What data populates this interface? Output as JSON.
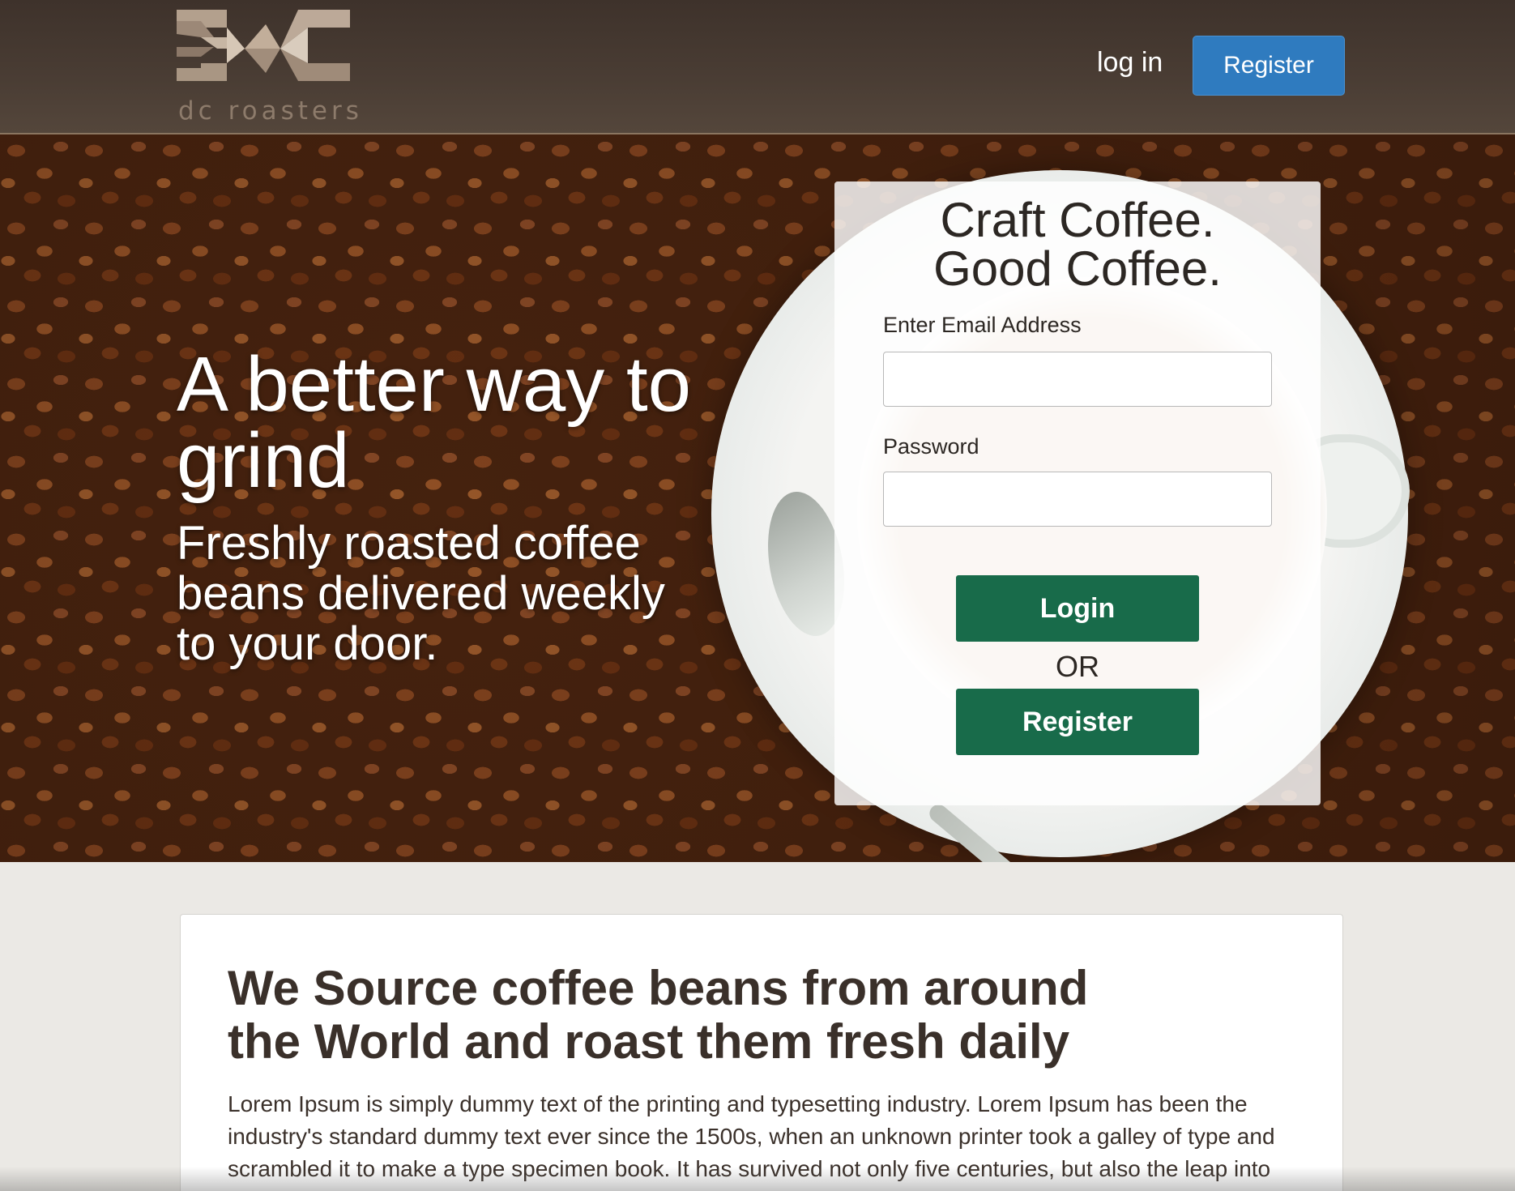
{
  "header": {
    "logo_text": "dc roasters",
    "login_label": "log in",
    "register_label": "Register"
  },
  "hero": {
    "title": "A better way to grind",
    "subtitle": "Freshly roasted coffee beans delivered weekly to your door."
  },
  "login_panel": {
    "title_line1": "Craft Coffee.",
    "title_line2": "Good Coffee.",
    "email_label": "Enter Email Address",
    "email_value": "",
    "password_label": "Password",
    "password_value": "",
    "login_button": "Login",
    "or_text": "OR",
    "register_button": "Register"
  },
  "about": {
    "heading": "We Source coffee beans from around the World and roast them fresh daily",
    "body": "Lorem Ipsum is simply dummy text of the printing and typesetting industry. Lorem Ipsum has been the industry's standard dummy text ever since the 1500s, when an unknown printer took a galley of type and scrambled it to make a type specimen book. It has survived not only five centuries, but also the leap into"
  },
  "colors": {
    "header_bg": "#4a3d34",
    "register_blue": "#2f7bbf",
    "button_green": "#186b4a",
    "page_bg": "#ebe9e5",
    "text_dark": "#3a302a"
  }
}
